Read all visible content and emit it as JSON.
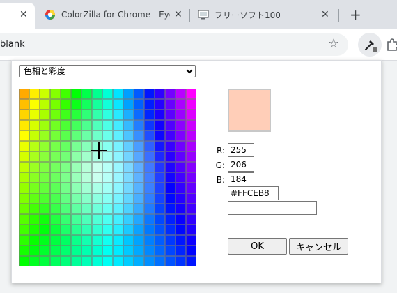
{
  "browser": {
    "tabs": [
      {
        "title": "",
        "close": "✕",
        "active": true
      },
      {
        "title": "ColorZilla for Chrome - Eyedropper",
        "close": "✕",
        "active": false
      },
      {
        "title": "フリーソフト100",
        "close": "✕",
        "active": false
      }
    ],
    "new_tab": "+",
    "omnibox_text": "blank",
    "star_icon": "☆"
  },
  "picker": {
    "mode_options": [
      "色相と彩度"
    ],
    "mode_selected": "色相と彩度",
    "grid_hue_cols": 17,
    "grid_rows": 17,
    "selected_color": "#FFCEB8",
    "labels": {
      "r": "R:",
      "g": "G:",
      "b": "B:"
    },
    "values": {
      "r": "255",
      "g": "206",
      "b": "184",
      "hex": "#FFCEB8",
      "extra": ""
    },
    "ok_label": "OK",
    "cancel_label": "キャンセル"
  }
}
